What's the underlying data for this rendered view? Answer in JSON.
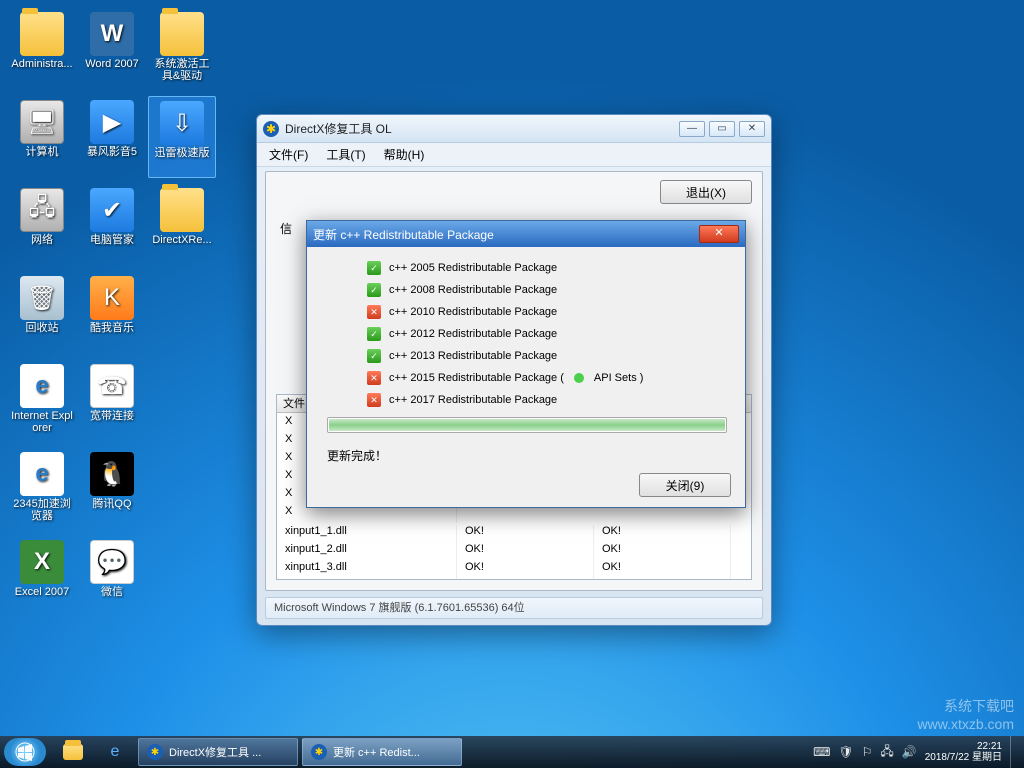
{
  "desktop": {
    "icons": [
      {
        "label": "Administra...",
        "cls": "ico-folder"
      },
      {
        "label": "Word 2007",
        "cls": "ico-word",
        "glyph": "W"
      },
      {
        "label": "系统激活工具&驱动",
        "cls": "ico-folder"
      },
      {
        "label": ""
      },
      {
        "label": "计算机",
        "cls": "ico-pc",
        "glyph": "🖥"
      },
      {
        "label": "暴风影音5",
        "cls": "ico-blue",
        "glyph": "▶"
      },
      {
        "label": "迅雷极速版",
        "cls": "ico-blue",
        "glyph": "⇩",
        "selected": true
      },
      {
        "label": ""
      },
      {
        "label": "网络",
        "cls": "ico-pc",
        "glyph": "🖧"
      },
      {
        "label": "电脑管家",
        "cls": "ico-blue",
        "glyph": "✔"
      },
      {
        "label": "DirectXRe...",
        "cls": "ico-folder"
      },
      {
        "label": ""
      },
      {
        "label": "回收站",
        "cls": "ico-trash",
        "glyph": "🗑"
      },
      {
        "label": "酷我音乐",
        "cls": "ico-orange",
        "glyph": "K"
      },
      {
        "label": ""
      },
      {
        "label": ""
      },
      {
        "label": "Internet Explorer",
        "cls": "ico-ie",
        "glyph": "e"
      },
      {
        "label": "宽带连接",
        "cls": "ico-app",
        "glyph": "☎"
      },
      {
        "label": ""
      },
      {
        "label": ""
      },
      {
        "label": "2345加速浏览器",
        "cls": "ico-ie",
        "glyph": "e"
      },
      {
        "label": "腾讯QQ",
        "cls": "ico-qq",
        "glyph": "🐧"
      },
      {
        "label": ""
      },
      {
        "label": ""
      },
      {
        "label": "Excel 2007",
        "cls": "ico-excel",
        "glyph": "X"
      },
      {
        "label": "微信",
        "cls": "ico-app",
        "glyph": "💬"
      }
    ]
  },
  "mainwin": {
    "title": "DirectX修复工具 OL",
    "menu": {
      "file": "文件(F)",
      "tools": "工具(T)",
      "help": "帮助(H)"
    },
    "exit": "退出(X)",
    "info": "信",
    "filehdr": "文件",
    "files": [
      {
        "name": "xinput1_1.dll",
        "c1": "OK!",
        "c2": "OK!"
      },
      {
        "name": "xinput1_2.dll",
        "c1": "OK!",
        "c2": "OK!"
      },
      {
        "name": "xinput1_3.dll",
        "c1": "OK!",
        "c2": "OK!"
      }
    ],
    "partial": [
      "X",
      "X",
      "X",
      "X",
      "X",
      "X"
    ],
    "osline": "Microsoft Windows 7 旗舰版 (6.1.7601.65536) 64位"
  },
  "modal": {
    "title": "更新 c++ Redistributable Package",
    "items": [
      {
        "ok": true,
        "text": "c++ 2005 Redistributable Package"
      },
      {
        "ok": true,
        "text": "c++ 2008 Redistributable Package"
      },
      {
        "ok": false,
        "text": "c++ 2010 Redistributable Package"
      },
      {
        "ok": true,
        "text": "c++ 2012 Redistributable Package"
      },
      {
        "ok": true,
        "text": "c++ 2013 Redistributable Package"
      },
      {
        "ok": false,
        "text": "c++ 2015 Redistributable Package (",
        "api": true,
        "text2": " API Sets )"
      },
      {
        "ok": false,
        "text": "c++ 2017 Redistributable Package"
      }
    ],
    "done": "更新完成！",
    "close": "关闭(9)"
  },
  "taskbar": {
    "task1": "DirectX修复工具 ...",
    "task2": "更新 c++ Redist...",
    "time": "22:21",
    "date": "2018/7/22 星期日"
  },
  "watermark": {
    "l1": "系统下载吧",
    "l2": "www.xtxzb.com"
  }
}
